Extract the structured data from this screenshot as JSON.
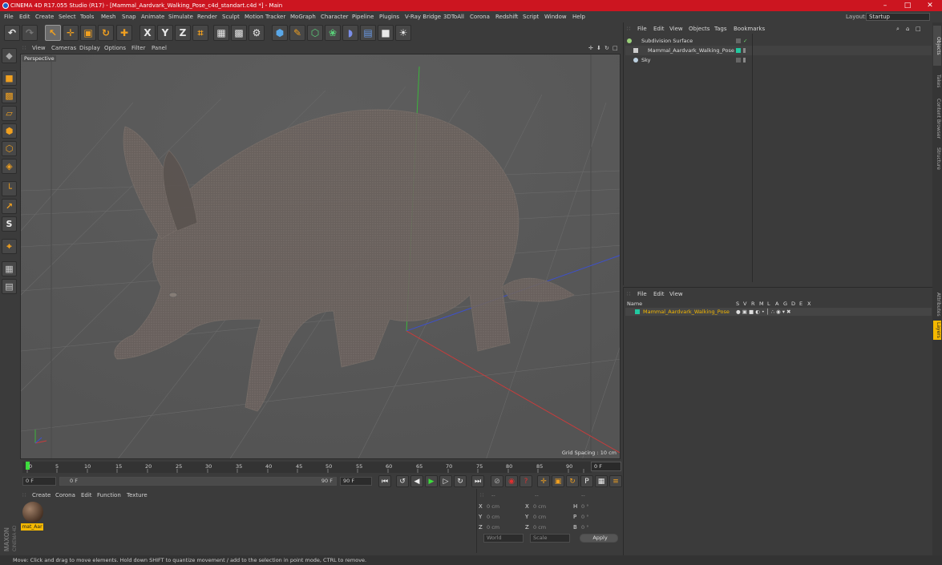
{
  "window": {
    "title": "CINEMA 4D R17.055 Studio (R17) - [Mammal_Aardvark_Walking_Pose_c4d_standart.c4d *] - Main",
    "minimize": "–",
    "restore": "□",
    "close": "✕"
  },
  "menubar": {
    "items": [
      "File",
      "Edit",
      "Create",
      "Select",
      "Tools",
      "Mesh",
      "Snap",
      "Animate",
      "Simulate",
      "Render",
      "Sculpt",
      "Motion Tracker",
      "MoGraph",
      "Character",
      "Pipeline",
      "Plugins",
      "V-Ray Bridge",
      "3DToAll",
      "Corona",
      "Redshift",
      "Script",
      "Window",
      "Help"
    ],
    "layout_label": "Layout:",
    "layout_value": "Startup"
  },
  "toolbar": {
    "icons": [
      "undo-icon",
      "redo-icon",
      "live-select-icon",
      "move-icon",
      "scale-icon",
      "rotate-icon",
      "add-icon",
      "x-axis-icon",
      "y-axis-icon",
      "z-axis-icon",
      "world-coord-icon",
      "render-view-icon",
      "render-picture-viewer-icon",
      "edit-render-settings-icon",
      "cube-icon",
      "pen-icon",
      "subdivision-icon",
      "array-icon",
      "deformer-icon",
      "floor-icon",
      "camera-icon",
      "light-icon"
    ],
    "axis_labels": [
      "X",
      "Y",
      "Z"
    ]
  },
  "left_tools": {
    "icons": [
      "make-editable-icon",
      "model-mode-icon",
      "texture-mode-icon",
      "workplane-icon",
      "points-mode-icon",
      "edges-mode-icon",
      "polygons-mode-icon",
      "axis-mode-icon",
      "tweak-icon",
      "soft-selection-icon",
      "snap-icon",
      "sculpt-icon",
      "lock-workplane-icon",
      "grid-icon"
    ]
  },
  "viewport": {
    "menu": [
      "View",
      "Cameras",
      "Display",
      "Options",
      "Filter",
      "Panel"
    ],
    "label": "Perspective",
    "grid_spacing": "Grid Spacing : 10 cm",
    "nav_icons": [
      "move-view-icon",
      "zoom-view-icon",
      "rotate-view-icon",
      "toggle-layout-icon"
    ]
  },
  "timeline": {
    "ticks": [
      "0",
      "5",
      "10",
      "15",
      "20",
      "25",
      "30",
      "35",
      "40",
      "45",
      "50",
      "55",
      "60",
      "65",
      "70",
      "75",
      "80",
      "85",
      "90"
    ],
    "current_frame": "0 F"
  },
  "transport": {
    "start_field": "0 F",
    "range_start": "0 F",
    "range_end": "90 F",
    "end_field": "90 F"
  },
  "material_manager": {
    "menu": [
      "Create",
      "Corona",
      "Edit",
      "Function",
      "Texture"
    ],
    "material_name": "mat_Aar"
  },
  "coordinates": {
    "rows": [
      {
        "a": "X",
        "av": "0 cm",
        "b": "X",
        "bv": "0 cm",
        "c": "H",
        "cv": "0 °"
      },
      {
        "a": "Y",
        "av": "0 cm",
        "b": "Y",
        "bv": "0 cm",
        "c": "P",
        "cv": "0 °"
      },
      {
        "a": "Z",
        "av": "0 cm",
        "b": "Z",
        "bv": "0 cm",
        "c": "B",
        "cv": "0 °"
      }
    ],
    "header": [
      "--",
      "--",
      "--"
    ],
    "mode1": "World",
    "mode2": "Scale",
    "apply": "Apply"
  },
  "objects_panel": {
    "menu": [
      "File",
      "Edit",
      "View",
      "Objects",
      "Tags",
      "Bookmarks"
    ],
    "items": [
      {
        "name": "Subdivision Surface",
        "color": "#9ad07a"
      },
      {
        "name": "Mammal_Aardvark_Walking_Pose",
        "color": "#22c9a0"
      },
      {
        "name": "Sky",
        "color": "#bcd0e0"
      }
    ]
  },
  "attributes_panel": {
    "menu": [
      "File",
      "Edit",
      "View"
    ],
    "columns": [
      "Name",
      "S",
      "V",
      "R",
      "M",
      "L",
      "A",
      "G",
      "D",
      "E",
      "X"
    ],
    "layer_name": "Mammal_Aardvark_Walking_Pose",
    "layer_color": "#22c9a0"
  },
  "right_tabs": [
    "Objects",
    "Takes",
    "Content Browser",
    "Structure"
  ],
  "right_tabs_lower": [
    "Attributes",
    "Layers"
  ],
  "status": "Move: Click and drag to move elements. Hold down SHIFT to quantize movement / add to the selection in point mode, CTRL to remove.",
  "brand": {
    "maxon": "MAXON",
    "cinema": "CINEMA 4D"
  },
  "colors": {
    "accent": "#f5b800",
    "title_red": "#cc1520",
    "axis_x": "#c83c3c",
    "axis_y": "#3cb43c",
    "axis_z": "#3c50d0"
  }
}
